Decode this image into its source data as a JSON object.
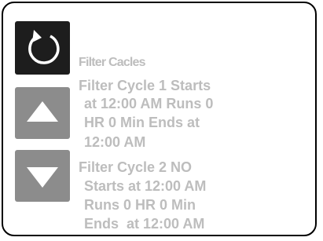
{
  "screen": {
    "title": "Filter Cacles",
    "lines": [
      "Filter Cycle 1 Starts",
      " at 12:00 AM Runs 0",
      " HR 0 Min Ends at",
      " 12:00 AM",
      "Filter Cycle 2 NO",
      " Starts at 12:00 AM",
      " Runs 0 HR 0 Min",
      " Ends  at 12:00 AM"
    ]
  },
  "buttons": {
    "back": "back-icon",
    "up": "up-arrow-icon",
    "down": "down-arrow-icon"
  },
  "colors": {
    "back_button": "#1d1d1d",
    "nav_button": "#8c8c8c",
    "text": "#bdbdbd"
  }
}
